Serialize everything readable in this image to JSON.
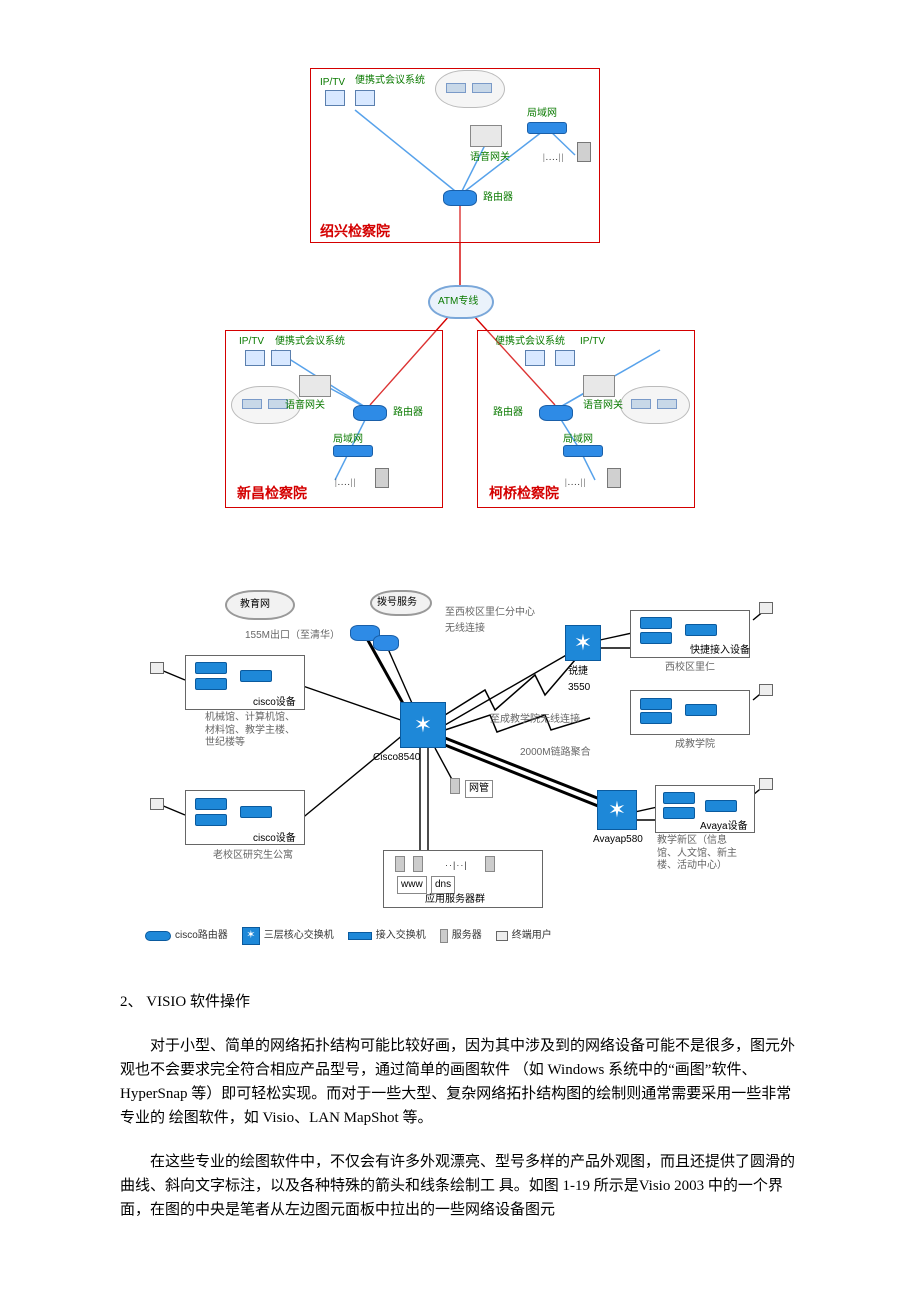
{
  "diagram1": {
    "site1_name": "绍兴检察院",
    "site2_name": "新昌检察院",
    "site3_name": "柯桥检察院",
    "atm_line": "ATM专线",
    "router": "路由器",
    "voice_gateway": "语音网关",
    "lan": "局域网",
    "iptv": "IP/TV",
    "portable": "便携式会议系统",
    "ellipsis": "|....||"
  },
  "diagram2": {
    "edu_net": "教育网",
    "dial_service": "拨号服务",
    "uplink": "155M出口（至清华）",
    "wireless1": "至西校区里仁分中心\n无线连接",
    "wireless2": "至成教学院无线连接",
    "agg2000": "2000M链路聚合",
    "cisco8540": "Cisco8540",
    "ruijie3550": "锐捷\n3550",
    "avaya580": "Avayap580",
    "netmgmt": "网管",
    "www": "www",
    "dns": "dns",
    "app_servers": "应用服务器群",
    "cisco_dev": "cisco设备",
    "avaya_dev": "Avaya设备",
    "quick_access": "快捷接入设备",
    "block1_caption": "机械馆、计算机馆、\n材料馆、教学主楼、\n世纪楼等",
    "block2_caption": "老校区研究生公寓",
    "block3_caption": "西校区里仁",
    "block4_caption": "成教学院",
    "block5_caption": "教学新区（信息\n馆、人文馆、新主\n楼、活动中心）",
    "legend_router": "cisco路由器",
    "legend_core": "三层核心交换机",
    "legend_access": "接入交换机",
    "legend_server": "服务器",
    "legend_pc": "终端用户"
  },
  "text": {
    "section_title": "2、 VISIO 软件操作",
    "para1": "对于小型、简单的网络拓扑结构可能比较好画，因为其中涉及到的网络设备可能不是很多，图元外观也不会要求完全符合相应产品型号，通过简单的画图软件 （如 Windows 系统中的“画图”软件、HyperSnap 等）即可轻松实现。而对于一些大型、复杂网络拓扑结构图的绘制则通常需要采用一些非常专业的 绘图软件，如 Visio、LAN MapShot 等。",
    "para2": "在这些专业的绘图软件中，不仅会有许多外观漂亮、型号多样的产品外观图，而且还提供了圆滑的曲线、斜向文字标注，以及各种特殊的箭头和线条绘制工 具。如图 1-19 所示是Visio 2003 中的一个界面，在图的中央是笔者从左边图元面板中拉出的一些网络设备图元"
  }
}
